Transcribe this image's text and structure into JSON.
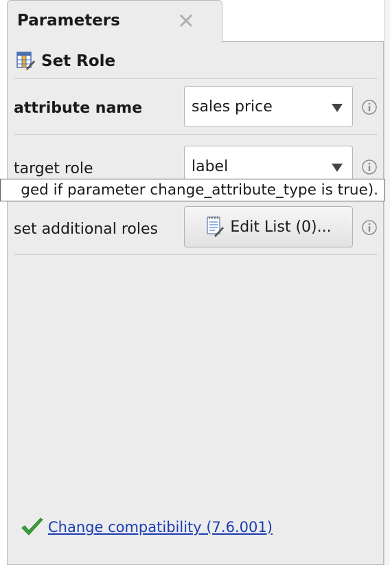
{
  "panel": {
    "tab_title": "Parameters",
    "close_icon": "close-icon"
  },
  "operator": {
    "title": "Set Role",
    "icon": "table-edit-icon"
  },
  "params": {
    "attribute_name": {
      "label": "attribute name",
      "value": "sales price"
    },
    "target_role": {
      "label": "target role",
      "value": "label"
    },
    "additional_roles": {
      "label": "set additional roles",
      "button_label": "Edit List (0)..."
    }
  },
  "tooltip": {
    "text": "ged if parameter change_attribute_type is true)."
  },
  "compatibility": {
    "link_text": "Change compatibility (7.6.001)"
  },
  "colors": {
    "panel_bg": "#ececec",
    "link": "#1a3cb3",
    "check": "#3aa13a"
  }
}
